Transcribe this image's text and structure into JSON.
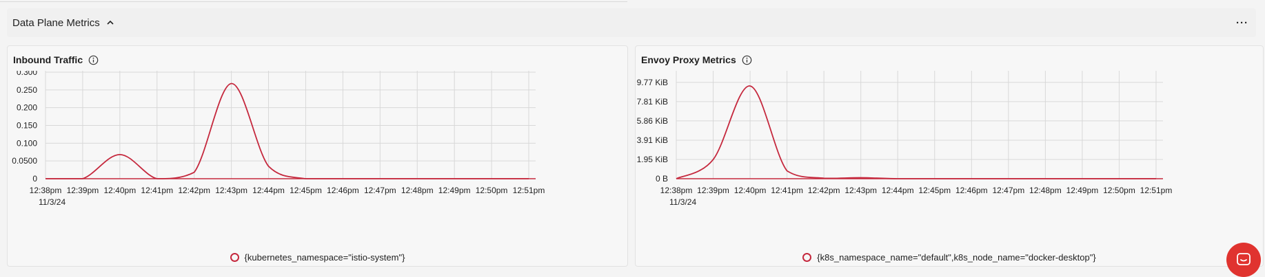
{
  "section": {
    "title": "Data Plane Metrics",
    "more_label": "···"
  },
  "colors": {
    "series": "#c5283d",
    "grid": "#d8d8d8",
    "axis_text": "#1f1f1f",
    "chat_button": "#e0332f"
  },
  "icons": {
    "collapse": "chevron-up-icon",
    "more": "more-horizontal-icon",
    "info": "info-icon",
    "chat": "chat-icon"
  },
  "panels": [
    {
      "title": "Inbound Traffic",
      "legend": "{kubernetes_namespace=\"istio-system\"}"
    },
    {
      "title": "Envoy Proxy Metrics",
      "legend": "{k8s_namespace_name=\"default\",k8s_node_name=\"docker-desktop\"}"
    }
  ],
  "chart_data": [
    {
      "type": "line",
      "title": "Inbound Traffic",
      "x": [
        "12:38pm",
        "12:39pm",
        "12:40pm",
        "12:41pm",
        "12:42pm",
        "12:43pm",
        "12:44pm",
        "12:45pm",
        "12:46pm",
        "12:47pm",
        "12:48pm",
        "12:49pm",
        "12:50pm",
        "12:51pm"
      ],
      "x_sublabel": "11/3/24",
      "y_ticks": [
        "0",
        "0.0500",
        "0.100",
        "0.150",
        "0.200",
        "0.250",
        "0.300"
      ],
      "ylim": [
        0,
        0.3
      ],
      "grid": true,
      "legend_position": "bottom",
      "series": [
        {
          "name": "{kubernetes_namespace=\"istio-system\"}",
          "values": [
            0,
            0.0,
            0.068,
            0.0,
            0.018,
            0.268,
            0.035,
            0.0,
            0,
            0,
            0,
            0,
            0,
            0
          ]
        }
      ]
    },
    {
      "type": "line",
      "title": "Envoy Proxy Metrics",
      "x": [
        "12:38pm",
        "12:39pm",
        "12:40pm",
        "12:41pm",
        "12:42pm",
        "12:43pm",
        "12:44pm",
        "12:45pm",
        "12:46pm",
        "12:47pm",
        "12:48pm",
        "12:49pm",
        "12:50pm",
        "12:51pm"
      ],
      "x_sublabel": "11/3/24",
      "y_ticks": [
        "0 B",
        "1.95 KiB",
        "3.91 KiB",
        "5.86 KiB",
        "7.81 KiB",
        "9.77 KiB"
      ],
      "ylim_kib": [
        0,
        10.8
      ],
      "grid": true,
      "legend_position": "bottom",
      "series": [
        {
          "name": "{k8s_namespace_name=\"default\",k8s_node_name=\"docker-desktop\"}",
          "values_kib": [
            0,
            1.95,
            9.4,
            0.8,
            0.05,
            0.1,
            0.0,
            0,
            0,
            0,
            0,
            0,
            0,
            0
          ]
        }
      ]
    }
  ]
}
